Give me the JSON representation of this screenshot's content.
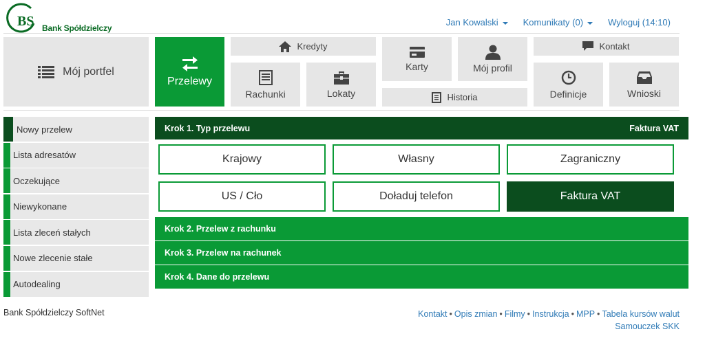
{
  "brand": {
    "logo_letters": "BS",
    "name": "Bank Spółdzielczy",
    "color": "#0a9a36"
  },
  "usernav": {
    "user": "Jan Kowalski",
    "messages": "Komunikaty (0)",
    "logout": "Wyloguj (14:10)"
  },
  "tiles": {
    "portfel": "Mój portfel",
    "przelewy": "Przelewy",
    "kredyty": "Kredyty",
    "rachunki": "Rachunki",
    "lokaty": "Lokaty",
    "karty": "Karty",
    "historia": "Historia",
    "profil": "Mój profil",
    "kontakt": "Kontakt",
    "definicje": "Definicje",
    "wnioski": "Wnioski"
  },
  "sidebar": {
    "items": [
      {
        "label": "Nowy przelew"
      },
      {
        "label": "Lista adresatów"
      },
      {
        "label": "Oczekujące"
      },
      {
        "label": "Niewykonane"
      },
      {
        "label": "Lista zleceń stałych"
      },
      {
        "label": "Nowe zlecenie stałe"
      },
      {
        "label": "Autodealing"
      }
    ]
  },
  "steps": {
    "step1": {
      "title": "Krok 1. Typ przelewu",
      "selected": "Faktura VAT"
    },
    "step2": "Krok 2. Przelew z rachunku",
    "step3": "Krok 3. Przelew na rachunek",
    "step4": "Krok 4. Dane do przelewu"
  },
  "transfer_types": [
    "Krajowy",
    "Własny",
    "Zagraniczny",
    "US / Cło",
    "Doładuj telefon",
    "Faktura VAT"
  ],
  "footer": {
    "left": "Bank Spółdzielczy SoftNet",
    "links": [
      "Kontakt",
      "Opis zmian",
      "Filmy",
      "Instrukcja",
      "MPP",
      "Tabela kursów walut"
    ],
    "link2": "Samouczek SKK",
    "separator": "•"
  },
  "colors": {
    "green": "#0a9a36",
    "dark_green": "#0b4d1e",
    "tile_gray": "#e6e6e6",
    "link_blue": "#2f7ab6"
  }
}
